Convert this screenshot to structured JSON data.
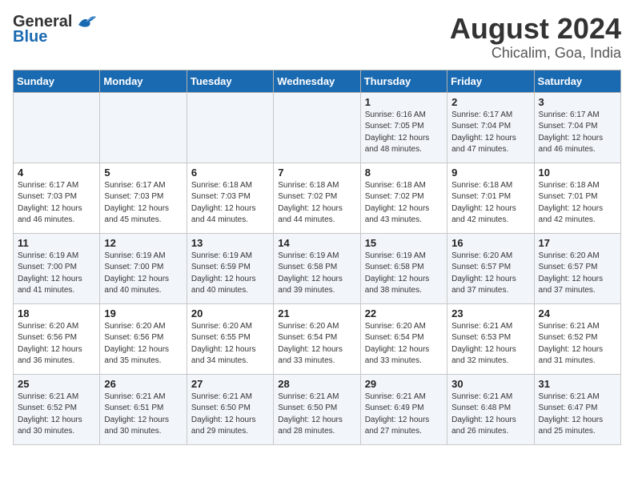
{
  "logo": {
    "general": "General",
    "blue": "Blue"
  },
  "title": "August 2024",
  "subtitle": "Chicalim, Goa, India",
  "days_of_week": [
    "Sunday",
    "Monday",
    "Tuesday",
    "Wednesday",
    "Thursday",
    "Friday",
    "Saturday"
  ],
  "weeks": [
    [
      {
        "day": "",
        "info": ""
      },
      {
        "day": "",
        "info": ""
      },
      {
        "day": "",
        "info": ""
      },
      {
        "day": "",
        "info": ""
      },
      {
        "day": "1",
        "info": "Sunrise: 6:16 AM\nSunset: 7:05 PM\nDaylight: 12 hours\nand 48 minutes."
      },
      {
        "day": "2",
        "info": "Sunrise: 6:17 AM\nSunset: 7:04 PM\nDaylight: 12 hours\nand 47 minutes."
      },
      {
        "day": "3",
        "info": "Sunrise: 6:17 AM\nSunset: 7:04 PM\nDaylight: 12 hours\nand 46 minutes."
      }
    ],
    [
      {
        "day": "4",
        "info": "Sunrise: 6:17 AM\nSunset: 7:03 PM\nDaylight: 12 hours\nand 46 minutes."
      },
      {
        "day": "5",
        "info": "Sunrise: 6:17 AM\nSunset: 7:03 PM\nDaylight: 12 hours\nand 45 minutes."
      },
      {
        "day": "6",
        "info": "Sunrise: 6:18 AM\nSunset: 7:03 PM\nDaylight: 12 hours\nand 44 minutes."
      },
      {
        "day": "7",
        "info": "Sunrise: 6:18 AM\nSunset: 7:02 PM\nDaylight: 12 hours\nand 44 minutes."
      },
      {
        "day": "8",
        "info": "Sunrise: 6:18 AM\nSunset: 7:02 PM\nDaylight: 12 hours\nand 43 minutes."
      },
      {
        "day": "9",
        "info": "Sunrise: 6:18 AM\nSunset: 7:01 PM\nDaylight: 12 hours\nand 42 minutes."
      },
      {
        "day": "10",
        "info": "Sunrise: 6:18 AM\nSunset: 7:01 PM\nDaylight: 12 hours\nand 42 minutes."
      }
    ],
    [
      {
        "day": "11",
        "info": "Sunrise: 6:19 AM\nSunset: 7:00 PM\nDaylight: 12 hours\nand 41 minutes."
      },
      {
        "day": "12",
        "info": "Sunrise: 6:19 AM\nSunset: 7:00 PM\nDaylight: 12 hours\nand 40 minutes."
      },
      {
        "day": "13",
        "info": "Sunrise: 6:19 AM\nSunset: 6:59 PM\nDaylight: 12 hours\nand 40 minutes."
      },
      {
        "day": "14",
        "info": "Sunrise: 6:19 AM\nSunset: 6:58 PM\nDaylight: 12 hours\nand 39 minutes."
      },
      {
        "day": "15",
        "info": "Sunrise: 6:19 AM\nSunset: 6:58 PM\nDaylight: 12 hours\nand 38 minutes."
      },
      {
        "day": "16",
        "info": "Sunrise: 6:20 AM\nSunset: 6:57 PM\nDaylight: 12 hours\nand 37 minutes."
      },
      {
        "day": "17",
        "info": "Sunrise: 6:20 AM\nSunset: 6:57 PM\nDaylight: 12 hours\nand 37 minutes."
      }
    ],
    [
      {
        "day": "18",
        "info": "Sunrise: 6:20 AM\nSunset: 6:56 PM\nDaylight: 12 hours\nand 36 minutes."
      },
      {
        "day": "19",
        "info": "Sunrise: 6:20 AM\nSunset: 6:56 PM\nDaylight: 12 hours\nand 35 minutes."
      },
      {
        "day": "20",
        "info": "Sunrise: 6:20 AM\nSunset: 6:55 PM\nDaylight: 12 hours\nand 34 minutes."
      },
      {
        "day": "21",
        "info": "Sunrise: 6:20 AM\nSunset: 6:54 PM\nDaylight: 12 hours\nand 33 minutes."
      },
      {
        "day": "22",
        "info": "Sunrise: 6:20 AM\nSunset: 6:54 PM\nDaylight: 12 hours\nand 33 minutes."
      },
      {
        "day": "23",
        "info": "Sunrise: 6:21 AM\nSunset: 6:53 PM\nDaylight: 12 hours\nand 32 minutes."
      },
      {
        "day": "24",
        "info": "Sunrise: 6:21 AM\nSunset: 6:52 PM\nDaylight: 12 hours\nand 31 minutes."
      }
    ],
    [
      {
        "day": "25",
        "info": "Sunrise: 6:21 AM\nSunset: 6:52 PM\nDaylight: 12 hours\nand 30 minutes."
      },
      {
        "day": "26",
        "info": "Sunrise: 6:21 AM\nSunset: 6:51 PM\nDaylight: 12 hours\nand 30 minutes."
      },
      {
        "day": "27",
        "info": "Sunrise: 6:21 AM\nSunset: 6:50 PM\nDaylight: 12 hours\nand 29 minutes."
      },
      {
        "day": "28",
        "info": "Sunrise: 6:21 AM\nSunset: 6:50 PM\nDaylight: 12 hours\nand 28 minutes."
      },
      {
        "day": "29",
        "info": "Sunrise: 6:21 AM\nSunset: 6:49 PM\nDaylight: 12 hours\nand 27 minutes."
      },
      {
        "day": "30",
        "info": "Sunrise: 6:21 AM\nSunset: 6:48 PM\nDaylight: 12 hours\nand 26 minutes."
      },
      {
        "day": "31",
        "info": "Sunrise: 6:21 AM\nSunset: 6:47 PM\nDaylight: 12 hours\nand 25 minutes."
      }
    ]
  ]
}
